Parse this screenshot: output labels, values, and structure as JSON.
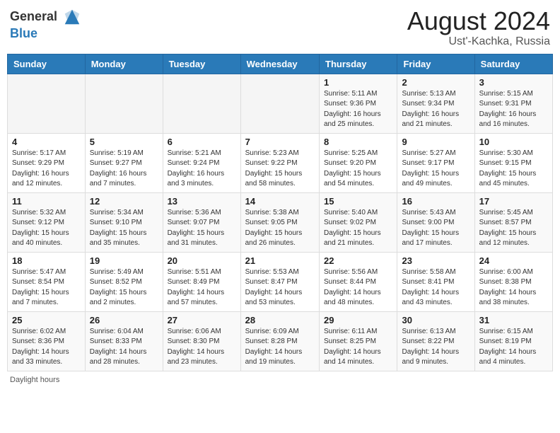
{
  "header": {
    "logo_line1": "General",
    "logo_line2": "Blue",
    "month_year": "August 2024",
    "location": "Ust'-Kachka, Russia"
  },
  "days_of_week": [
    "Sunday",
    "Monday",
    "Tuesday",
    "Wednesday",
    "Thursday",
    "Friday",
    "Saturday"
  ],
  "footer_label": "Daylight hours",
  "weeks": [
    [
      {
        "num": "",
        "info": ""
      },
      {
        "num": "",
        "info": ""
      },
      {
        "num": "",
        "info": ""
      },
      {
        "num": "",
        "info": ""
      },
      {
        "num": "1",
        "info": "Sunrise: 5:11 AM\nSunset: 9:36 PM\nDaylight: 16 hours\nand 25 minutes."
      },
      {
        "num": "2",
        "info": "Sunrise: 5:13 AM\nSunset: 9:34 PM\nDaylight: 16 hours\nand 21 minutes."
      },
      {
        "num": "3",
        "info": "Sunrise: 5:15 AM\nSunset: 9:31 PM\nDaylight: 16 hours\nand 16 minutes."
      }
    ],
    [
      {
        "num": "4",
        "info": "Sunrise: 5:17 AM\nSunset: 9:29 PM\nDaylight: 16 hours\nand 12 minutes."
      },
      {
        "num": "5",
        "info": "Sunrise: 5:19 AM\nSunset: 9:27 PM\nDaylight: 16 hours\nand 7 minutes."
      },
      {
        "num": "6",
        "info": "Sunrise: 5:21 AM\nSunset: 9:24 PM\nDaylight: 16 hours\nand 3 minutes."
      },
      {
        "num": "7",
        "info": "Sunrise: 5:23 AM\nSunset: 9:22 PM\nDaylight: 15 hours\nand 58 minutes."
      },
      {
        "num": "8",
        "info": "Sunrise: 5:25 AM\nSunset: 9:20 PM\nDaylight: 15 hours\nand 54 minutes."
      },
      {
        "num": "9",
        "info": "Sunrise: 5:27 AM\nSunset: 9:17 PM\nDaylight: 15 hours\nand 49 minutes."
      },
      {
        "num": "10",
        "info": "Sunrise: 5:30 AM\nSunset: 9:15 PM\nDaylight: 15 hours\nand 45 minutes."
      }
    ],
    [
      {
        "num": "11",
        "info": "Sunrise: 5:32 AM\nSunset: 9:12 PM\nDaylight: 15 hours\nand 40 minutes."
      },
      {
        "num": "12",
        "info": "Sunrise: 5:34 AM\nSunset: 9:10 PM\nDaylight: 15 hours\nand 35 minutes."
      },
      {
        "num": "13",
        "info": "Sunrise: 5:36 AM\nSunset: 9:07 PM\nDaylight: 15 hours\nand 31 minutes."
      },
      {
        "num": "14",
        "info": "Sunrise: 5:38 AM\nSunset: 9:05 PM\nDaylight: 15 hours\nand 26 minutes."
      },
      {
        "num": "15",
        "info": "Sunrise: 5:40 AM\nSunset: 9:02 PM\nDaylight: 15 hours\nand 21 minutes."
      },
      {
        "num": "16",
        "info": "Sunrise: 5:43 AM\nSunset: 9:00 PM\nDaylight: 15 hours\nand 17 minutes."
      },
      {
        "num": "17",
        "info": "Sunrise: 5:45 AM\nSunset: 8:57 PM\nDaylight: 15 hours\nand 12 minutes."
      }
    ],
    [
      {
        "num": "18",
        "info": "Sunrise: 5:47 AM\nSunset: 8:54 PM\nDaylight: 15 hours\nand 7 minutes."
      },
      {
        "num": "19",
        "info": "Sunrise: 5:49 AM\nSunset: 8:52 PM\nDaylight: 15 hours\nand 2 minutes."
      },
      {
        "num": "20",
        "info": "Sunrise: 5:51 AM\nSunset: 8:49 PM\nDaylight: 14 hours\nand 57 minutes."
      },
      {
        "num": "21",
        "info": "Sunrise: 5:53 AM\nSunset: 8:47 PM\nDaylight: 14 hours\nand 53 minutes."
      },
      {
        "num": "22",
        "info": "Sunrise: 5:56 AM\nSunset: 8:44 PM\nDaylight: 14 hours\nand 48 minutes."
      },
      {
        "num": "23",
        "info": "Sunrise: 5:58 AM\nSunset: 8:41 PM\nDaylight: 14 hours\nand 43 minutes."
      },
      {
        "num": "24",
        "info": "Sunrise: 6:00 AM\nSunset: 8:38 PM\nDaylight: 14 hours\nand 38 minutes."
      }
    ],
    [
      {
        "num": "25",
        "info": "Sunrise: 6:02 AM\nSunset: 8:36 PM\nDaylight: 14 hours\nand 33 minutes."
      },
      {
        "num": "26",
        "info": "Sunrise: 6:04 AM\nSunset: 8:33 PM\nDaylight: 14 hours\nand 28 minutes."
      },
      {
        "num": "27",
        "info": "Sunrise: 6:06 AM\nSunset: 8:30 PM\nDaylight: 14 hours\nand 23 minutes."
      },
      {
        "num": "28",
        "info": "Sunrise: 6:09 AM\nSunset: 8:28 PM\nDaylight: 14 hours\nand 19 minutes."
      },
      {
        "num": "29",
        "info": "Sunrise: 6:11 AM\nSunset: 8:25 PM\nDaylight: 14 hours\nand 14 minutes."
      },
      {
        "num": "30",
        "info": "Sunrise: 6:13 AM\nSunset: 8:22 PM\nDaylight: 14 hours\nand 9 minutes."
      },
      {
        "num": "31",
        "info": "Sunrise: 6:15 AM\nSunset: 8:19 PM\nDaylight: 14 hours\nand 4 minutes."
      }
    ]
  ]
}
